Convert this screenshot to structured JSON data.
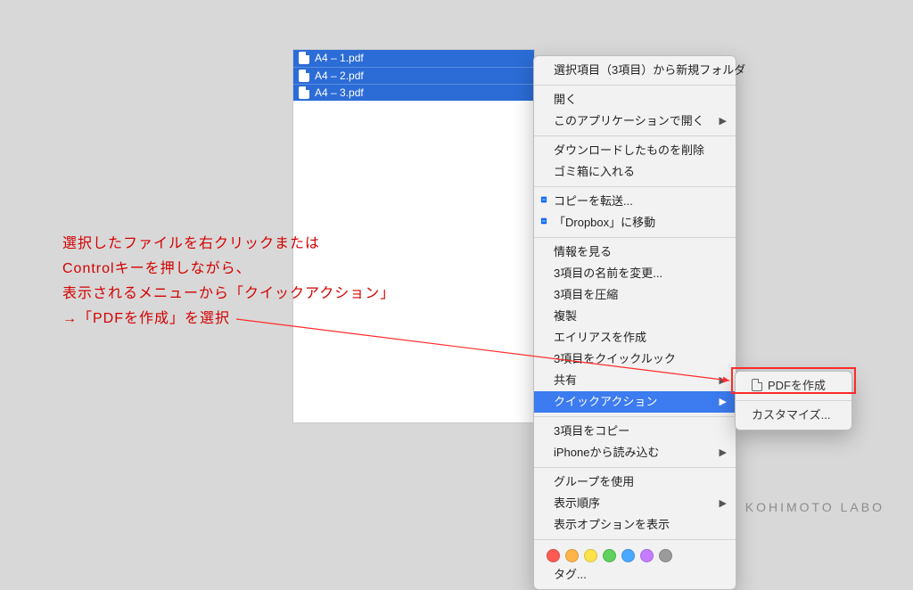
{
  "files": [
    {
      "name": "A4 – 1.pdf"
    },
    {
      "name": "A4 – 2.pdf"
    },
    {
      "name": "A4 – 3.pdf"
    }
  ],
  "context_menu": {
    "new_folder": "選択項目（3項目）から新規フォルダ",
    "open": "開く",
    "open_with": "このアプリケーションで開く",
    "delete_download": "ダウンロードしたものを削除",
    "trash": "ゴミ箱に入れる",
    "copy_transfer": "コピーを転送...",
    "dropbox": "「Dropbox」に移動",
    "get_info": "情報を見る",
    "rename": "3項目の名前を変更...",
    "compress": "3項目を圧縮",
    "duplicate": "複製",
    "alias": "エイリアスを作成",
    "quicklook": "3項目をクイックルック",
    "share": "共有",
    "quick_action": "クイックアクション",
    "copy_items": "3項目をコピー",
    "import_iphone": "iPhoneから読み込む",
    "use_group": "グループを使用",
    "sort_order": "表示順序",
    "show_options": "表示オプションを表示",
    "tags_label": "タグ..."
  },
  "submenu": {
    "create_pdf": "PDFを作成",
    "customize": "カスタマイズ..."
  },
  "annotation": {
    "line1": "選択したファイルを右クリックまたは",
    "line2": "Controlキーを押しながら、",
    "line3": "表示されるメニューから「クイックアクション」",
    "line4": "→「PDFを作成」を選択"
  },
  "tag_colors": [
    "#ff5a52",
    "#ffb44a",
    "#ffe24a",
    "#5ed15e",
    "#4aa8ff",
    "#c57cff",
    "#9b9b9b"
  ],
  "watermark": "KOHIMOTO LABO"
}
